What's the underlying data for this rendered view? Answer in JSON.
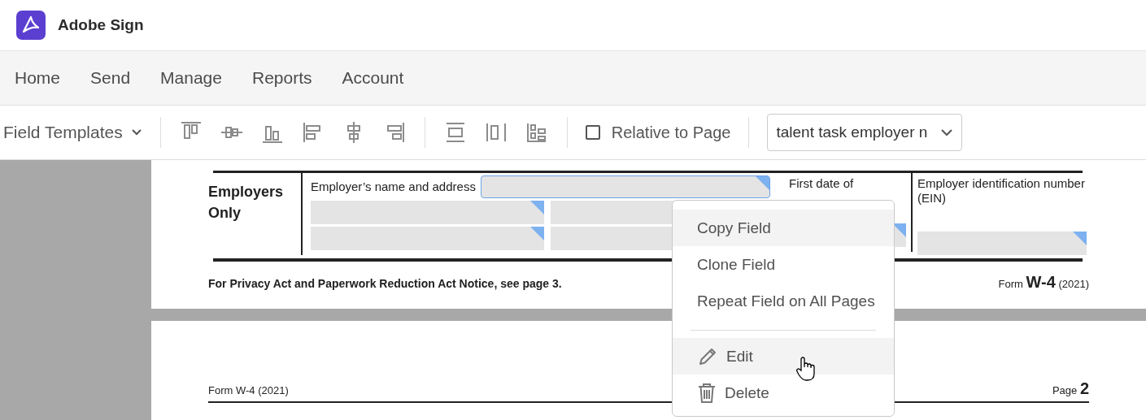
{
  "app": {
    "title": "Adobe Sign"
  },
  "nav": [
    {
      "label": "Home"
    },
    {
      "label": "Send"
    },
    {
      "label": "Manage"
    },
    {
      "label": "Reports"
    },
    {
      "label": "Account"
    }
  ],
  "toolbar": {
    "templates_label": "Field Templates",
    "relative_to_page": {
      "label": "Relative to Page",
      "checked": false
    },
    "field_select": {
      "value": "talent task employer n"
    }
  },
  "page_1": {
    "section_title": "Employers Only",
    "name_label": "Employer’s name and address",
    "date_label_line_1": "First date of",
    "ein_label": "Employer identification number (EIN)",
    "notice": "For Privacy Act and Paperwork Reduction Act Notice, see page 3.",
    "form_prefix": "Form",
    "form_name": "W-4",
    "form_year": "(2021)",
    "fields": [
      {
        "selected": true
      },
      {
        "selected": false
      },
      {
        "selected": false
      },
      {
        "selected": false
      },
      {
        "selected": false
      },
      {
        "selected": false
      },
      {
        "selected": false
      }
    ]
  },
  "page_2": {
    "form_ref": "Form W-4 (2021)",
    "page_prefix": "Page",
    "page_number": "2"
  },
  "context_menu": {
    "items": [
      {
        "kind": "text",
        "label": "Copy Field",
        "highlighted": true
      },
      {
        "kind": "text",
        "label": "Clone Field",
        "highlighted": false
      },
      {
        "kind": "text",
        "label": "Repeat Field on All Pages",
        "highlighted": false
      },
      {
        "kind": "divider"
      },
      {
        "kind": "edit",
        "label": "Edit",
        "highlighted": true
      },
      {
        "kind": "delete",
        "label": "Delete",
        "highlighted": false
      }
    ]
  }
}
